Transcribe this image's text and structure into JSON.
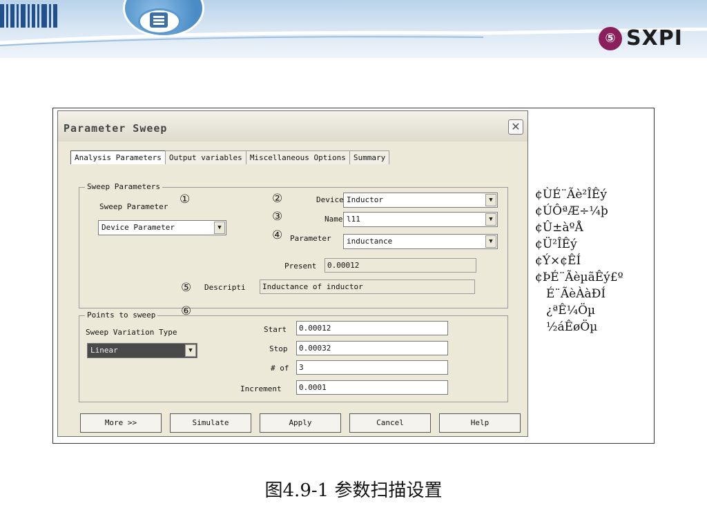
{
  "slide": {
    "logo_text": "SXPI",
    "caption": "图4.9-1  参数扫描设置",
    "side_items": [
      "¢ÙÉ¨Ãè²ÎÊý",
      "¢ÚÔªÆ÷¼þ",
      "¢Û±àºÅ",
      "¢Ü²ÎÊý",
      "¢Ý×¢ÊÍ",
      "¢ÞÉ¨ÃèµãÊý£º"
    ],
    "side_subitems": [
      "É¨ÃèÀàÐÍ",
      "¿ªÊ¼Öµ",
      "½áÊøÖµ"
    ]
  },
  "dialog": {
    "title": "Parameter Sweep",
    "close_glyph": "✕",
    "tabs": [
      "Analysis Parameters",
      "Output variables",
      "Miscellaneous Options",
      "Summary"
    ],
    "sweep_group": {
      "label": "Sweep Parameters",
      "sweep_parameter_label": "Sweep Parameter",
      "sweep_parameter_value": "Device Parameter",
      "device_label": "Device",
      "device_value": "Inductor",
      "name_label": "Name",
      "name_value": "l11",
      "parameter_label": "Parameter",
      "parameter_value": "inductance",
      "present_label": "Present",
      "present_value": "0.00012",
      "description_label": "Descripti",
      "description_value": "Inductance of inductor"
    },
    "points_group": {
      "label": "Points to sweep",
      "variation_label": "Sweep Variation Type",
      "variation_value": "Linear",
      "start_label": "Start",
      "start_value": "0.00012",
      "stop_label": "Stop",
      "stop_value": "0.00032",
      "num_label": "# of",
      "num_value": "3",
      "increment_label": "Increment",
      "increment_value": "0.0001"
    },
    "markers": [
      "①",
      "②",
      "③",
      "④",
      "⑤",
      "⑥"
    ],
    "dropdown_glyph": "▼",
    "buttons": [
      "More >>",
      "Simulate",
      "Apply",
      "Cancel",
      "Help"
    ]
  }
}
